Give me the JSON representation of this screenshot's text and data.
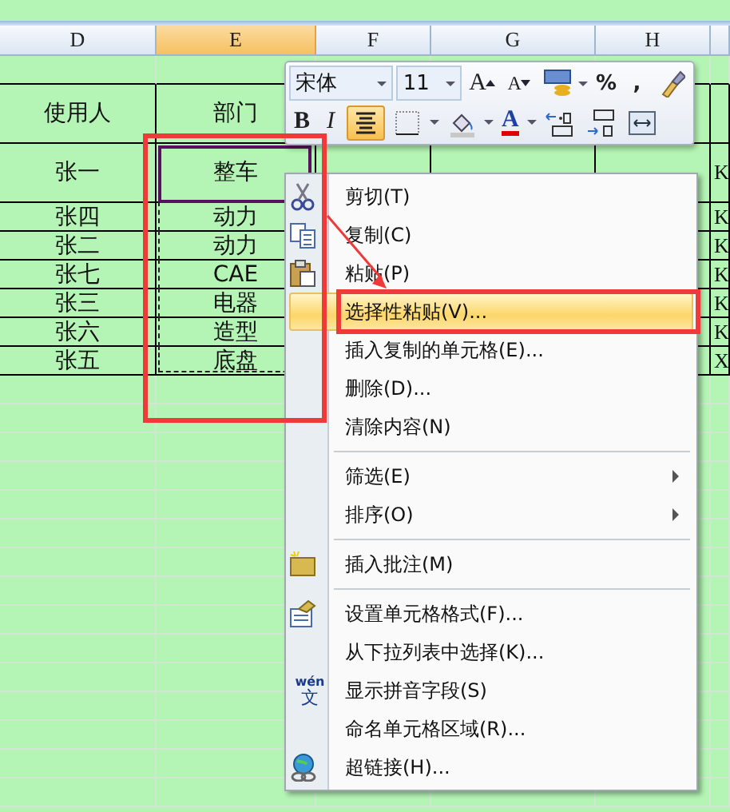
{
  "columns": [
    {
      "label": "D",
      "selected": false
    },
    {
      "label": "E",
      "selected": true
    },
    {
      "label": "F",
      "selected": false
    },
    {
      "label": "G",
      "selected": false
    },
    {
      "label": "H",
      "selected": false
    }
  ],
  "rows": [
    {
      "kind": "tall",
      "cells": [
        "使用人",
        "部门"
      ]
    },
    {
      "kind": "tall",
      "cells": [
        "张一",
        "整车"
      ],
      "edge_cell": "K",
      "copied": true,
      "active": true
    },
    {
      "kind": "normal",
      "cells": [
        "张四",
        "动力"
      ],
      "edge_cell": "K",
      "copied": true
    },
    {
      "kind": "normal",
      "cells": [
        "张二",
        "动力"
      ],
      "edge_cell": "K",
      "copied": true
    },
    {
      "kind": "normal",
      "cells": [
        "张七",
        "CAE"
      ],
      "edge_cell": "K",
      "copied": true
    },
    {
      "kind": "normal",
      "cells": [
        "张三",
        "电器"
      ],
      "edge_cell": "K",
      "copied": true
    },
    {
      "kind": "normal",
      "cells": [
        "张六",
        "造型"
      ],
      "edge_cell": "K",
      "copied": true
    },
    {
      "kind": "normal",
      "cells": [
        "张五",
        "底盘"
      ],
      "edge_cell": "X",
      "copied": true
    }
  ],
  "toolbar": {
    "font": "宋体",
    "size": "11",
    "top_row": [
      {
        "kind": "grow-font",
        "label": "A",
        "on": false
      },
      {
        "kind": "shrink-font",
        "label": "A",
        "on": false
      },
      {
        "kind": "currency",
        "on": false,
        "dropdown": true
      },
      {
        "kind": "text",
        "label": "%",
        "on": false
      },
      {
        "kind": "text",
        "label": ",",
        "on": false
      },
      {
        "kind": "painter",
        "on": false
      }
    ],
    "bottom_row": [
      {
        "kind": "bold",
        "label": "B",
        "on": false
      },
      {
        "kind": "italic",
        "label": "I",
        "on": false
      },
      {
        "kind": "align-center",
        "on": true
      },
      {
        "kind": "borders",
        "on": false,
        "dropdown": true
      },
      {
        "kind": "fill",
        "on": false,
        "dropdown": true
      },
      {
        "kind": "font-color",
        "label": "A",
        "on": false,
        "dropdown": true
      },
      {
        "kind": "inc-decimal",
        "on": false
      },
      {
        "kind": "dec-decimal",
        "on": false
      },
      {
        "kind": "merge",
        "on": false
      }
    ]
  },
  "menu": {
    "items": [
      {
        "label": "剪切(T)",
        "kind": "scissors",
        "selected": false
      },
      {
        "label": "复制(C)",
        "kind": "copy",
        "selected": false
      },
      {
        "label": "粘贴(P)",
        "kind": "paste",
        "selected": false
      },
      {
        "label": "选择性粘贴(V)...",
        "selected": true
      },
      {
        "label": "插入复制的单元格(E)...",
        "selected": false
      },
      {
        "label": "删除(D)...",
        "selected": false
      },
      {
        "label": "清除内容(N)",
        "selected": false
      },
      {
        "label": "筛选(E)",
        "selected": false,
        "separator_before": true,
        "submenu": true
      },
      {
        "label": "排序(O)",
        "selected": false,
        "submenu": true
      },
      {
        "label": "插入批注(M)",
        "kind": "note",
        "selected": false,
        "separator_before": true
      },
      {
        "label": "设置单元格格式(F)...",
        "kind": "format",
        "selected": false,
        "separator_before": true
      },
      {
        "label": "从下拉列表中选择(K)...",
        "selected": false
      },
      {
        "label": "显示拼音字段(S)",
        "kind": "pinyin",
        "icon_top": "wén",
        "icon_bottom": "文",
        "selected": false
      },
      {
        "label": "命名单元格区域(R)...",
        "selected": false
      },
      {
        "label": "超链接(H)...",
        "kind": "link",
        "selected": false
      }
    ]
  },
  "annotations": {
    "range_frame": true,
    "item_frame": true,
    "arrow": true
  }
}
